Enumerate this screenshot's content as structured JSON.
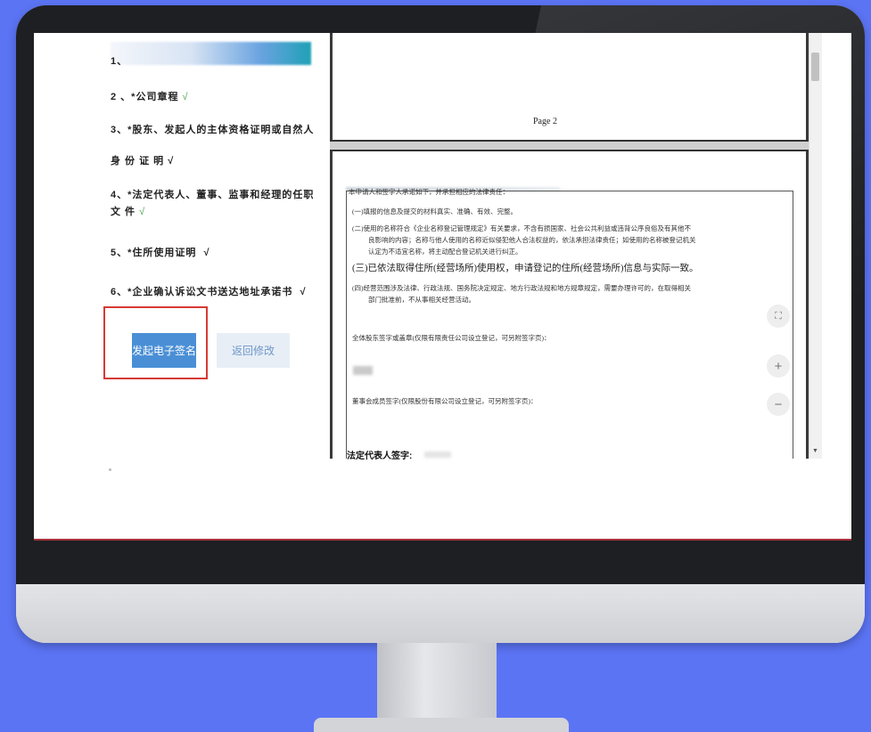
{
  "checklist": {
    "item1": "1、",
    "item2": "2 、*公司章程",
    "item2_check": "√",
    "item3_line1": "3、*股东、发起人的主体资格证明或自然人",
    "item3_line2": "身 份 证 明",
    "item3_check": "√",
    "item4_line1": "4、*法定代表人、董事、监事和经理的任职",
    "item4_line2": "文 件",
    "item4_check": "√",
    "item5": "5、*住所使用证明",
    "item5_check": "√",
    "item6": "6、*企业确认诉讼文书送达地址承诺书",
    "item6_check": "√"
  },
  "actions": {
    "sign_label": "发起电子签名",
    "back_label": "返回修改"
  },
  "viewer": {
    "page_label": "Page   2",
    "doc_lines": {
      "intro": "本申请人和签字人承诺如下，并承担相应的法律责任：",
      "p1": "(一)填报的信息及提交的材料真实、准确、有效、完整。",
      "p2a": "(二)使用的名称符合《企业名称登记管理规定》有关要求，不含有损国家、社会公共利益或违背公序良俗及有其他不",
      "p2b": "良影响的内容；名称与他人使用的名称近似侵犯他人合法权益的，依法承担法律责任；如使用的名称被登记机关",
      "p2c": "认定为不适宜名称，将主动配合登记机关进行纠正。",
      "p3": "(三)已依法取得住所(经营场所)使用权，申请登记的住所(经营场所)信息与实际一致。",
      "p4a": "(四)经营范围涉及法律、行政法规、国务院决定规定、地方行政法规和地方规章规定，需要办理许可的，在取得相关",
      "p4b": "部门批准前，不从事相关经营活动。",
      "shareholders": "全体股东签字或盖章(仅限有限责任公司设立登记，可另附签字页)：",
      "directors": "董事会成员签字(仅限股份有限公司设立登记，可另附签字页)："
    },
    "legal_rep_label": "法定代表人签字:",
    "zoom_in_label": "+",
    "zoom_out_label": "−",
    "fit_label": "⛶"
  }
}
